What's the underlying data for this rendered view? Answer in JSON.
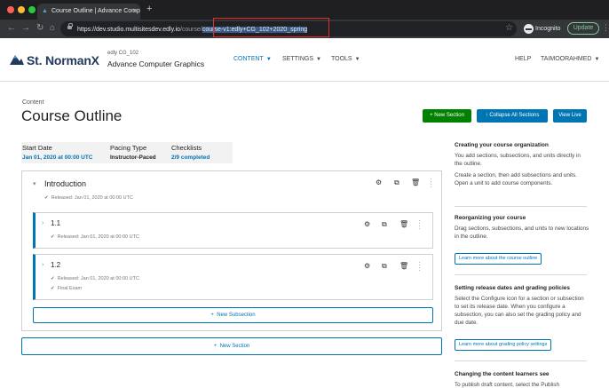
{
  "browser": {
    "tab_title": "Course Outline | Advance Comp",
    "url_host": "https://dev.studio.multisitesdev.edly.io",
    "url_path": "/course/",
    "url_selected": "course-v1:edly+CG_102+2020_spring",
    "incognito_label": "Incognito",
    "update_label": "Update"
  },
  "header": {
    "logo_text": "St. NormanX",
    "course_org": "edly CG_102",
    "course_name": "Advance Computer Graphics",
    "nav": {
      "content": "CONTENT",
      "settings": "SETTINGS",
      "tools": "TOOLS",
      "help": "HELP",
      "user": "TAIMOORAHMED"
    }
  },
  "page": {
    "eyebrow": "Content",
    "title": "Course Outline",
    "actions": {
      "new_section": "New Section",
      "collapse_all": "Collapse All Sections",
      "view_live": "View Live"
    },
    "meta": {
      "start_label": "Start Date",
      "start_value": "Jan 01, 2020 at 00:00 UTC",
      "pacing_label": "Pacing Type",
      "pacing_value": "Instructor-Paced",
      "checklists_label": "Checklists",
      "checklists_value": "2/9 completed"
    }
  },
  "outline": {
    "section": {
      "title": "Introduction",
      "released": "Released: Jan 01, 2020 at 00:00 UTC"
    },
    "subsections": [
      {
        "title": "1.1",
        "released": "Released: Jan 01, 2020 at 00:00 UTC",
        "extra": ""
      },
      {
        "title": "1.2",
        "released": "Released: Jan 01, 2020 at 00:00 UTC",
        "extra": "Final Exam"
      }
    ],
    "new_subsection": "New Subsection",
    "new_section": "New Section"
  },
  "sidebar": {
    "org_title": "Creating your course organization",
    "org_p1": "You add sections, subsections, and units directly in the outline.",
    "org_p2": "Create a section, then add subsections and units. Open a unit to add course components.",
    "reorg_title": "Reorganizing your course",
    "reorg_p": "Drag sections, subsections, and units to new locations in the outline.",
    "reorg_link": "Learn more about the course outline",
    "release_title": "Setting release dates and grading policies",
    "release_p": "Select the Configure icon for a section or subsection to set its release date. When you configure a subsection, you can also set the grading policy and due date.",
    "release_link": "Learn more about grading policy settings",
    "visibility_title": "Changing the content learners see",
    "visibility_p": "To publish draft content, select the Publish"
  },
  "colors": {
    "accent": "#0075b4",
    "success": "#008100",
    "highlight_box": "#e0312d"
  }
}
